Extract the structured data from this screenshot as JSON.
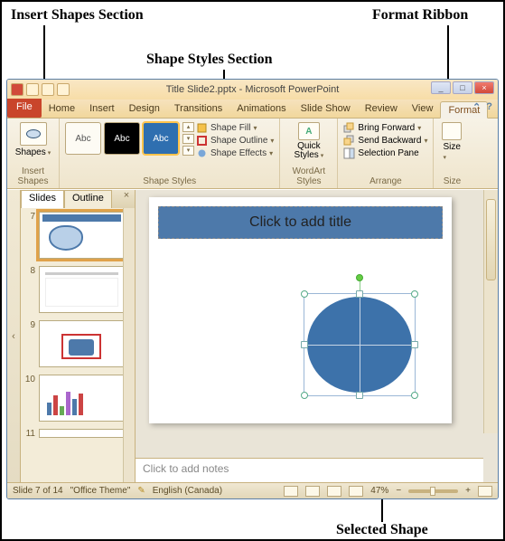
{
  "annotations": {
    "insert_shapes": "Insert Shapes Section",
    "shape_styles": "Shape Styles Section",
    "format_ribbon": "Format Ribbon",
    "selected_shape": "Selected Shape"
  },
  "titlebar": {
    "title": "Title Slide2.pptx - Microsoft PowerPoint",
    "min": "_",
    "max": "□",
    "close": "×"
  },
  "tabs": {
    "file": "File",
    "home": "Home",
    "insert": "Insert",
    "design": "Design",
    "transitions": "Transitions",
    "animations": "Animations",
    "slide_show": "Slide Show",
    "review": "Review",
    "view": "View",
    "format": "Format"
  },
  "ribbon": {
    "insert_shapes": {
      "shapes_btn": "Shapes",
      "group_label": "Insert Shapes"
    },
    "shape_styles": {
      "thumb_text": "Abc",
      "shape_fill": "Shape Fill",
      "shape_outline": "Shape Outline",
      "shape_effects": "Shape Effects",
      "group_label": "Shape Styles"
    },
    "wordart": {
      "quick_styles": "Quick Styles",
      "group_label": "WordArt Styles"
    },
    "arrange": {
      "bring_forward": "Bring Forward",
      "send_backward": "Send Backward",
      "selection_pane": "Selection Pane",
      "group_label": "Arrange"
    },
    "size": {
      "size_btn": "Size",
      "group_label": "Size"
    }
  },
  "outline_tabs": {
    "slides": "Slides",
    "outline": "Outline"
  },
  "thumbs": {
    "n7": "7",
    "n8": "8",
    "n9": "9",
    "n10": "10",
    "n11": "11"
  },
  "slide": {
    "title_placeholder": "Click to add title"
  },
  "notes": {
    "placeholder": "Click to add notes"
  },
  "status": {
    "slide_of": "Slide 7 of 14",
    "theme": "\"Office Theme\"",
    "language": "English (Canada)",
    "zoom": "47%"
  }
}
